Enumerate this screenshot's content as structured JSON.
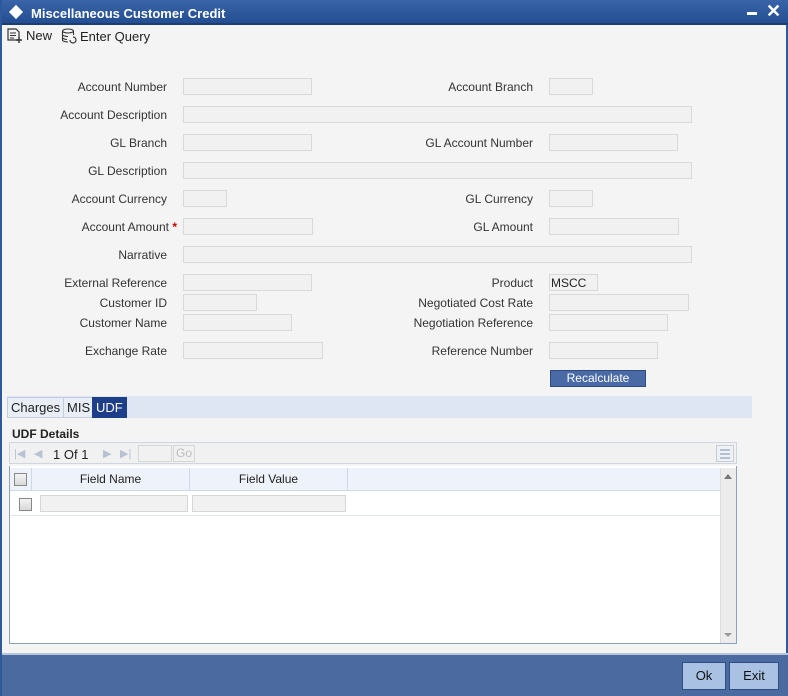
{
  "window": {
    "title": "Miscellaneous Customer Credit",
    "minimize_label": "minimize",
    "close_glyph": "✕"
  },
  "toolbar": {
    "new_label": "New",
    "enter_query_label": "Enter Query"
  },
  "form": {
    "account_number": {
      "label": "Account Number",
      "value": ""
    },
    "account_branch": {
      "label": "Account Branch",
      "value": ""
    },
    "account_description": {
      "label": "Account Description",
      "value": ""
    },
    "gl_branch": {
      "label": "GL Branch",
      "value": ""
    },
    "gl_account_number": {
      "label": "GL Account Number",
      "value": ""
    },
    "gl_description": {
      "label": "GL Description",
      "value": ""
    },
    "account_currency": {
      "label": "Account Currency",
      "value": ""
    },
    "gl_currency": {
      "label": "GL Currency",
      "value": ""
    },
    "account_amount": {
      "label": "Account Amount",
      "required_mark": "*",
      "value": ""
    },
    "gl_amount": {
      "label": "GL Amount",
      "value": ""
    },
    "narrative": {
      "label": "Narrative",
      "value": ""
    },
    "external_reference": {
      "label": "External Reference",
      "value": ""
    },
    "product": {
      "label": "Product",
      "value": "MSCC"
    },
    "customer_id": {
      "label": "Customer ID",
      "value": ""
    },
    "negotiated_cost_rate": {
      "label": "Negotiated Cost Rate",
      "value": ""
    },
    "customer_name": {
      "label": "Customer Name",
      "value": ""
    },
    "negotiation_reference": {
      "label": "Negotiation Reference",
      "value": ""
    },
    "exchange_rate": {
      "label": "Exchange Rate",
      "value": ""
    },
    "reference_number": {
      "label": "Reference Number",
      "value": ""
    },
    "recalculate_label": "Recalculate"
  },
  "tabs": [
    {
      "label": "Charges",
      "active": false
    },
    {
      "label": "MIS",
      "active": false
    },
    {
      "label": "UDF",
      "active": true
    }
  ],
  "udf": {
    "section_title": "UDF Details",
    "pager": {
      "current": "1",
      "of_label": "Of",
      "total": "1",
      "page_input": "",
      "go_label": "Go"
    },
    "columns": [
      "Field Name",
      "Field Value"
    ],
    "rows": [
      {
        "field_name": "",
        "field_value": ""
      }
    ]
  },
  "footer": {
    "ok_label": "Ok",
    "exit_label": "Exit"
  },
  "colors": {
    "titlebar": "#234e92",
    "footer": "#4a6aa0",
    "active_tab": "#1d3f8a",
    "button": "#a9c1e3"
  }
}
